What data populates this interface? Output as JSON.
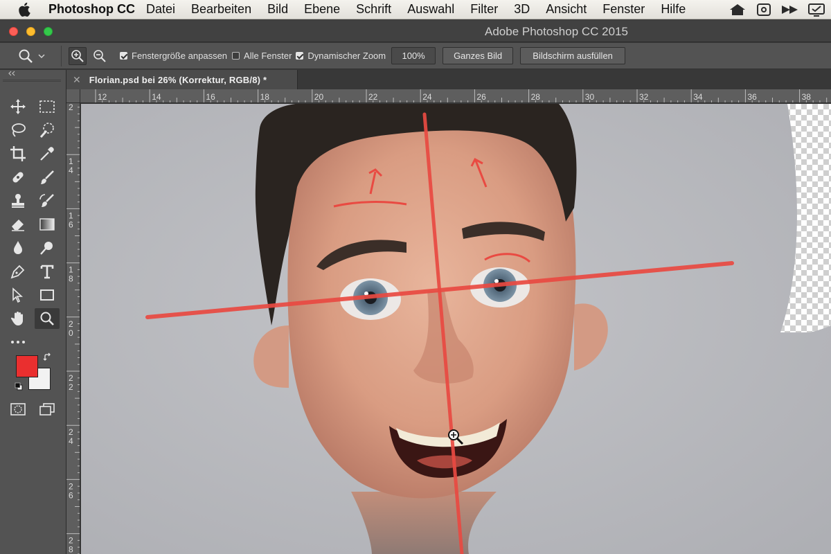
{
  "menubar": {
    "app_name": "Photoshop CC",
    "items": [
      "Datei",
      "Bearbeiten",
      "Bild",
      "Ebene",
      "Schrift",
      "Auswahl",
      "Filter",
      "3D",
      "Ansicht",
      "Fenster",
      "Hilfe"
    ]
  },
  "window": {
    "title": "Adobe Photoshop CC 2015"
  },
  "options": {
    "resize_windows_label": "Fenstergröße anpassen",
    "resize_windows_checked": true,
    "all_windows_label": "Alle Fenster",
    "all_windows_checked": false,
    "scrubby_zoom_label": "Dynamischer Zoom",
    "scrubby_zoom_checked": true,
    "zoom_value": "100%",
    "fit_screen_label": "Ganzes Bild",
    "fill_screen_label": "Bildschirm ausfüllen"
  },
  "document": {
    "tab_label": "Florian.psd bei 26% (Korrektur, RGB/8) *"
  },
  "rulers": {
    "top": [
      "12",
      "14",
      "16",
      "18",
      "20",
      "22",
      "24",
      "26",
      "28",
      "30",
      "32",
      "34",
      "36",
      "38"
    ],
    "left": [
      "2",
      "1 4",
      "1 6",
      "1 8",
      "2 0",
      "2 2",
      "2 4",
      "2 6",
      "2 8"
    ]
  },
  "colors": {
    "foreground": "#ea2f2f",
    "background": "#f2f2f2",
    "guide_red": "#e94a42"
  },
  "tools": [
    "move-icon",
    "marquee-icon",
    "lasso-icon",
    "quick-selection-icon",
    "crop-icon",
    "eyedropper-icon",
    "healing-brush-icon",
    "brush-icon",
    "clone-stamp-icon",
    "history-brush-icon",
    "eraser-icon",
    "gradient-icon",
    "blur-icon",
    "dodge-icon",
    "pen-icon",
    "type-icon",
    "path-selection-icon",
    "rectangle-icon",
    "hand-icon",
    "zoom-icon",
    "more-tools-icon"
  ]
}
